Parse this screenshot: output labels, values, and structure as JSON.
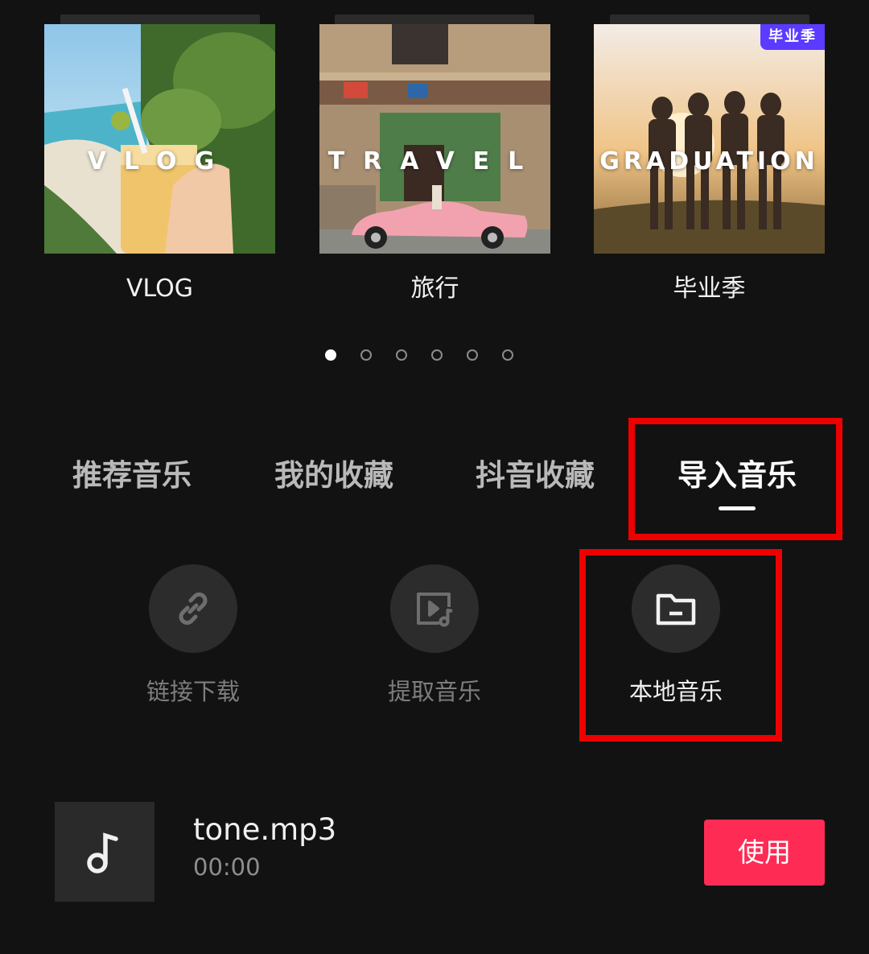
{
  "playlists": [
    {
      "cover_text": "VLOG",
      "label": "VLOG",
      "badge": ""
    },
    {
      "cover_text": "TRAVEL",
      "label": "旅行",
      "badge": ""
    },
    {
      "cover_text": "GRADUATION",
      "label": "毕业季",
      "badge": "毕业季"
    }
  ],
  "pager": {
    "total": 6,
    "active_index": 0
  },
  "tabs": [
    {
      "label": "推荐音乐",
      "active": false
    },
    {
      "label": "我的收藏",
      "active": false
    },
    {
      "label": "抖音收藏",
      "active": false
    },
    {
      "label": "导入音乐",
      "active": true
    }
  ],
  "import_options": [
    {
      "icon": "link-icon",
      "label": "链接下载",
      "enabled": false
    },
    {
      "icon": "video-music-icon",
      "label": "提取音乐",
      "enabled": false
    },
    {
      "icon": "folder-icon",
      "label": "本地音乐",
      "enabled": true
    }
  ],
  "file": {
    "icon": "music-note-icon",
    "name": "tone.mp3",
    "duration": "00:00",
    "action_label": "使用"
  },
  "colors": {
    "background": "#121212",
    "accent": "#fe2c55",
    "highlight_frame": "#ee0000",
    "badge": "#5b3bff"
  }
}
